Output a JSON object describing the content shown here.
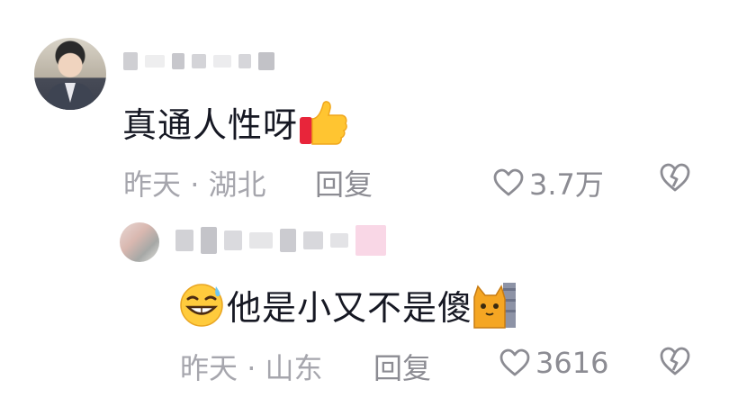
{
  "comments": [
    {
      "text": "真通人性呀",
      "emoji_after": "thumbs-up",
      "time": "昨天",
      "location": "湖北",
      "reply_label": "回复",
      "likes": "3.7万"
    },
    {
      "text": "他是小又不是傻",
      "emoji_before": "sweat-grin",
      "emoji_after": "cat-peek",
      "time": "昨天",
      "location": "山东",
      "reply_label": "回复",
      "likes": "3616"
    }
  ],
  "separator": "·",
  "colors": {
    "text": "#161823",
    "meta": "#a6a6ad",
    "action": "#8c8c93"
  }
}
